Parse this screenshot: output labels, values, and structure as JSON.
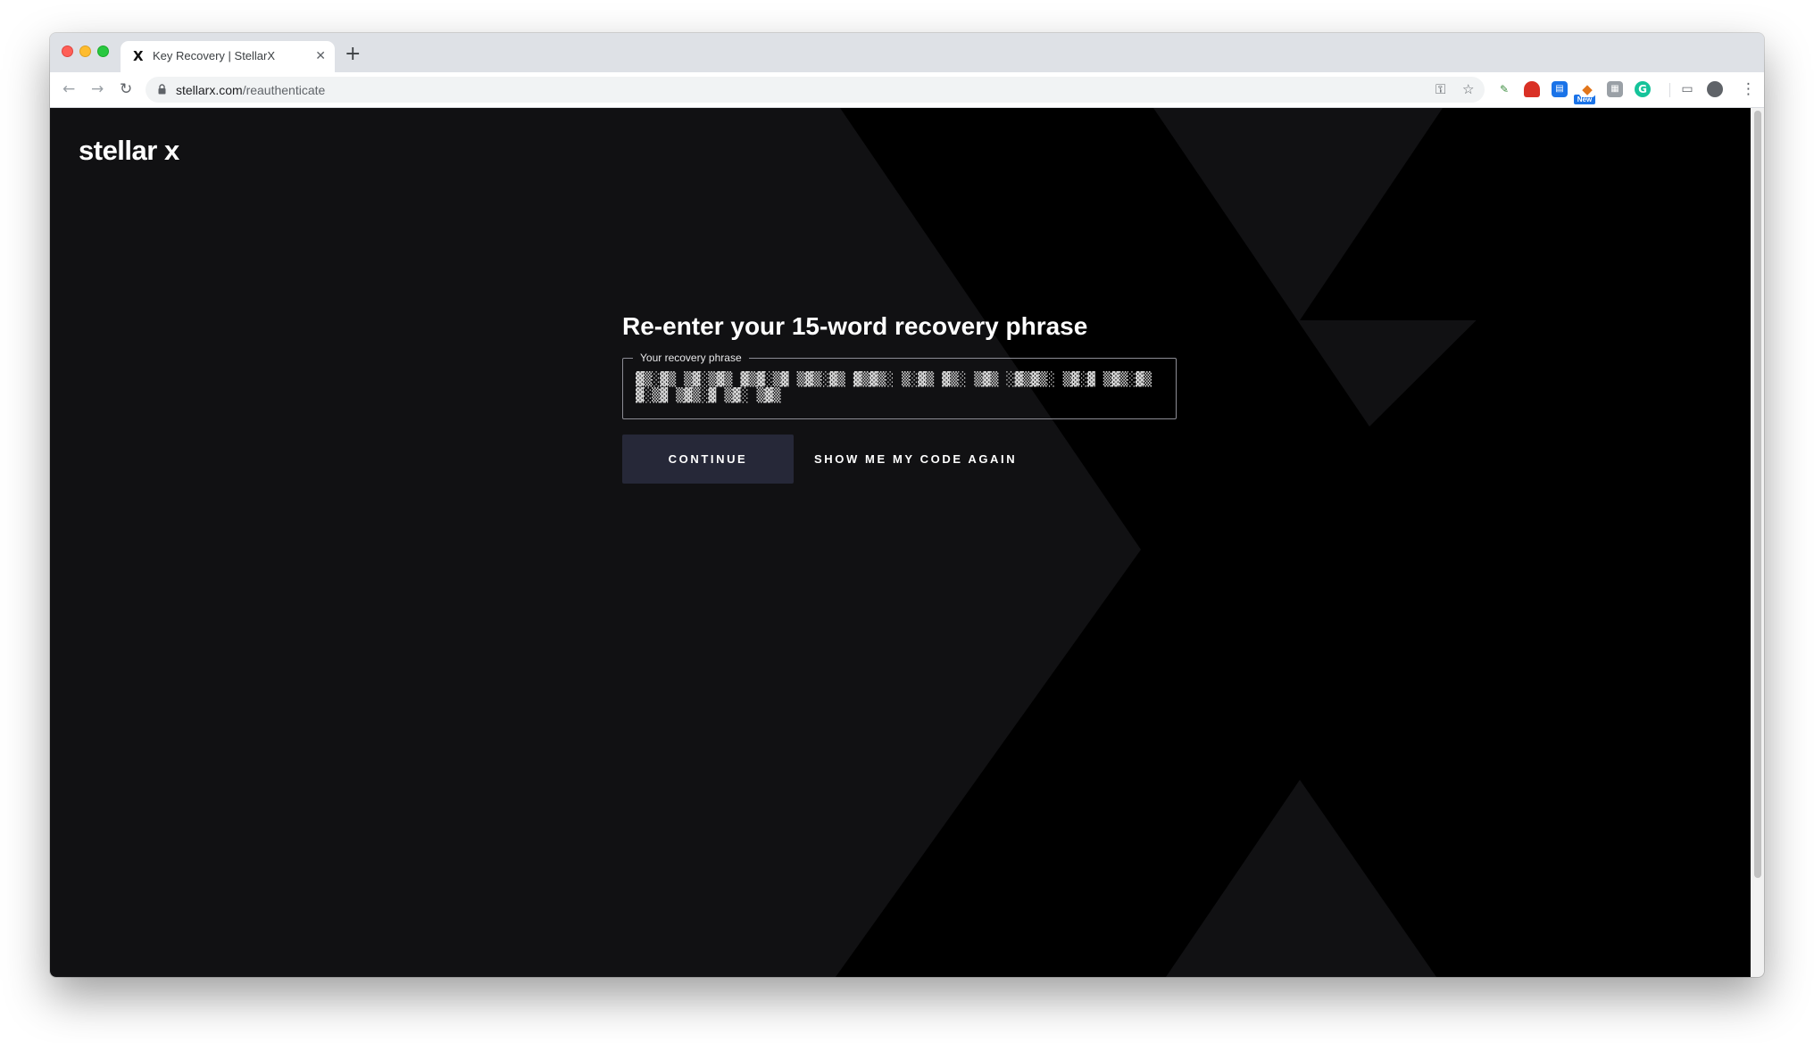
{
  "browser": {
    "tab": {
      "favicon": "X",
      "title": "Key Recovery | StellarX",
      "close": "✕"
    },
    "new_tab": "+",
    "nav": {
      "back": "←",
      "forward": "→",
      "reload": "↻"
    },
    "address": {
      "domain": "stellarx.com",
      "path": "/reauthenticate"
    },
    "omnibox_icons": {
      "key": "⚿",
      "star": "☆"
    },
    "extensions": {
      "new_badge": "New"
    },
    "menu": "⋮"
  },
  "page": {
    "logo": "stellar x",
    "heading": "Re-enter your 15-word recovery phrase",
    "phrase_field": {
      "label": "Your recovery phrase",
      "value": "▓▒░▓▒ ▒▓░▒▓▒ ▓▒▓░▒▓ ▒▓▒░▓▒ ▓▒▓▒░ ▒░▓▒ ▓▒░ ▒▓▒ ░▓▒▓▒░ ▒▓░▓ ▒▓▒░▓▒ ▓░▒▓ ▒▓▒░▓ ▒▓░ ▒▓▒"
    },
    "continue_label": "CONTINUE",
    "show_code_label": "SHOW ME MY CODE AGAIN"
  },
  "colors": {
    "page_bg": "#111113",
    "x_shape": "#000000",
    "continue_bg": "#262838",
    "text": "#ffffff"
  }
}
